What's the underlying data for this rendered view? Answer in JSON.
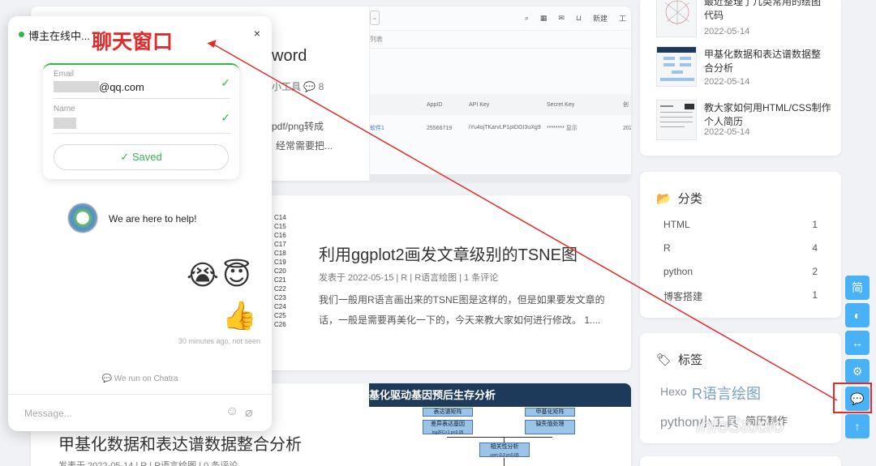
{
  "chat": {
    "status": "博主在线中...",
    "close": "×",
    "email_label": "Email",
    "email_value": "@qq.com",
    "name_label": "Name",
    "saved_label": "Saved",
    "help_text": "We are here to help!",
    "emoji_1": "😭",
    "emoji_2": "😇",
    "emoji_3": "👍",
    "timestamp": "30 minutes ago, not seen",
    "powered_by": "We run on Chatra",
    "message_placeholder": "Message..."
  },
  "annotation": {
    "label": "聊天窗口",
    "color": "#e32a2a"
  },
  "post1": {
    "title_fragment": "word",
    "meta_fragment": "小工具",
    "comments": "8",
    "excerpt_1": "pdf/png转成",
    "excerpt_2": "经常需要把...",
    "thumb": {
      "tab": "列表",
      "icon_labels": [
        "新建",
        "工"
      ],
      "columns": [
        "AppID",
        "API Key",
        "Secret Key",
        "创"
      ],
      "row": {
        "link": "软件1",
        "appid": "25566719",
        "apikey": "iYu4ojTKarvLP1pIDGI3uXg9",
        "secret": "******** 显示",
        "last": "202"
      }
    }
  },
  "post2": {
    "title": "利用ggplot2画发文章级别的TSNE图",
    "meta": "发表于 2022-05-15 | R | R语言绘图 | 1 条评论",
    "excerpt_1": "我们一般用R语言画出来的TSNE图是这样的，但是如果要发文章的",
    "excerpt_2": "话，一般是需要再美化一下的，今天来教大家如何进行修改。 1....",
    "labels": [
      "C14",
      "C15",
      "C16",
      "C17",
      "C18",
      "C19",
      "C20",
      "C21",
      "C22",
      "C23",
      "C24",
      "C25",
      "C26"
    ]
  },
  "post3": {
    "title": "甲基化数据和表达谱数据整合分析",
    "meta": "发表于 2022-05-14 | R | R语言绘图 | 0 条评论",
    "thumb_title": "基化驱动基因预后生存分析",
    "boxes": [
      "表达谱矩阵",
      "差异表达基因",
      "甲基化矩阵",
      "缺失值处理",
      "相关性分析"
    ],
    "box_subs": [
      "log2FC>1 p<0.05",
      "cor<-0.3 p<0.05"
    ]
  },
  "sidebar": {
    "recent": [
      {
        "title_1": "最近整理了几类常用的绘图",
        "title_2": "代码",
        "date": "2022-05-14"
      },
      {
        "title_1": "甲基化数据和表达谱数据整",
        "title_2": "合分析",
        "date": "2022-05-14"
      },
      {
        "title_1": "教大家如何用HTML/CSS制作",
        "title_2": "个人简历",
        "date": "2022-05-14"
      }
    ],
    "categories_title": "分类",
    "categories": [
      {
        "name": "HTML",
        "count": "1"
      },
      {
        "name": "R",
        "count": "4"
      },
      {
        "name": "python",
        "count": "2"
      },
      {
        "name": "博客搭建",
        "count": "1"
      }
    ],
    "tags_title": "标签",
    "tags": [
      "Hexo",
      "R语言绘图",
      "python小工具",
      "简历制作"
    ]
  },
  "float_buttons": {
    "simplified": "简"
  },
  "watermark": "InfoStudio"
}
